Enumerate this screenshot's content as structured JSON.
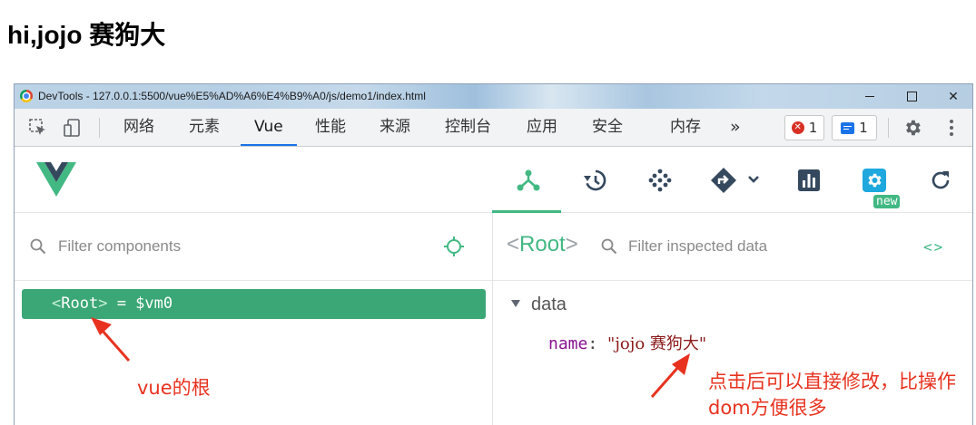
{
  "page": {
    "heading": "hi,jojo 赛狗大"
  },
  "window": {
    "title": "DevTools - 127.0.0.1:5500/vue%E5%AD%A6%E4%B9%A0/js/demo1/index.html"
  },
  "toolbar": {
    "tabs": [
      {
        "label": "网络"
      },
      {
        "label": "元素"
      },
      {
        "label": "Vue",
        "active": true
      },
      {
        "label": "性能"
      },
      {
        "label": "来源"
      },
      {
        "label": "控制台"
      },
      {
        "label": "应用"
      },
      {
        "label": "安全"
      },
      {
        "label": "内存"
      }
    ],
    "more": "»",
    "error_count": "1",
    "message_count": "1"
  },
  "vue_header": {
    "buttons": [
      {
        "name": "components-tree-icon",
        "active": true
      },
      {
        "name": "timeline-history-icon"
      },
      {
        "name": "performance-dots-icon"
      },
      {
        "name": "router-direction-icon"
      },
      {
        "name": "bar-chart-icon"
      },
      {
        "name": "settings-gear-icon"
      },
      {
        "name": "refresh-icon"
      }
    ],
    "new_badge": "new",
    "accent_color": "#42b883"
  },
  "components": {
    "filter_placeholder": "Filter components",
    "root": {
      "lt": "<",
      "name": "Root",
      "gt": ">",
      "suffix": " = $vm0"
    }
  },
  "inspector": {
    "root_lt": "<",
    "root_name": "Root",
    "root_gt": ">",
    "filter_placeholder": "Filter inspected data",
    "code_toggle": "<>",
    "section": "data",
    "prop_key": "name",
    "prop_colon": ":",
    "prop_value": "\"jojo 赛狗大\""
  },
  "annotations": {
    "root_note": "vue的根",
    "edit_note_line1": "点击后可以直接修改，比操作",
    "edit_note_line2": "dom方便很多",
    "color": "#e8321f"
  }
}
